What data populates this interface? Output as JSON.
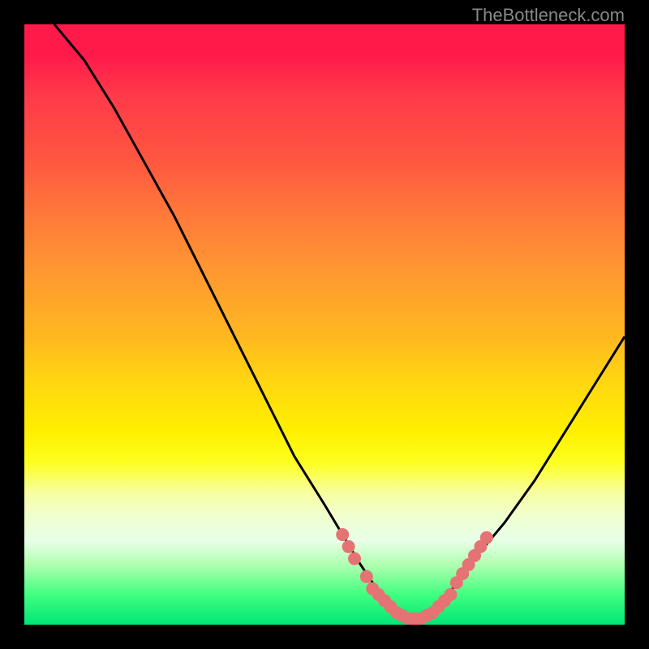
{
  "watermark": "TheBottleneck.com",
  "chart_data": {
    "type": "line",
    "title": "",
    "xlabel": "",
    "ylabel": "",
    "xlim": [
      0,
      100
    ],
    "ylim": [
      0,
      100
    ],
    "series": [
      {
        "name": "bottleneck-curve",
        "x": [
          5,
          10,
          15,
          20,
          25,
          30,
          35,
          40,
          45,
          50,
          53,
          56,
          58,
          60,
          62,
          64,
          66,
          68,
          70,
          72,
          75,
          80,
          85,
          90,
          95,
          100
        ],
        "y": [
          100,
          94,
          86,
          77,
          68,
          58,
          48,
          38,
          28,
          20,
          15,
          10,
          7,
          4,
          2,
          1,
          1,
          2,
          4,
          7,
          11,
          17,
          24,
          32,
          40,
          48
        ]
      }
    ],
    "markers": [
      {
        "x": 53,
        "y": 15
      },
      {
        "x": 54,
        "y": 13
      },
      {
        "x": 55,
        "y": 11
      },
      {
        "x": 57,
        "y": 8
      },
      {
        "x": 58,
        "y": 6
      },
      {
        "x": 59,
        "y": 5
      },
      {
        "x": 60,
        "y": 4
      },
      {
        "x": 61,
        "y": 3
      },
      {
        "x": 62,
        "y": 2
      },
      {
        "x": 63,
        "y": 1.5
      },
      {
        "x": 64,
        "y": 1
      },
      {
        "x": 65,
        "y": 1
      },
      {
        "x": 66,
        "y": 1
      },
      {
        "x": 67,
        "y": 1.5
      },
      {
        "x": 68,
        "y": 2
      },
      {
        "x": 69,
        "y": 3
      },
      {
        "x": 70,
        "y": 4
      },
      {
        "x": 71,
        "y": 5
      },
      {
        "x": 72,
        "y": 7
      },
      {
        "x": 73,
        "y": 8.5
      },
      {
        "x": 74,
        "y": 10
      },
      {
        "x": 75,
        "y": 11.5
      },
      {
        "x": 76,
        "y": 13
      },
      {
        "x": 77,
        "y": 14.5
      }
    ],
    "marker_color": "#e57373",
    "curve_color": "#000000",
    "gradient_colors": {
      "top": "#ff1a4a",
      "mid": "#fff000",
      "bottom": "#00e676"
    }
  }
}
